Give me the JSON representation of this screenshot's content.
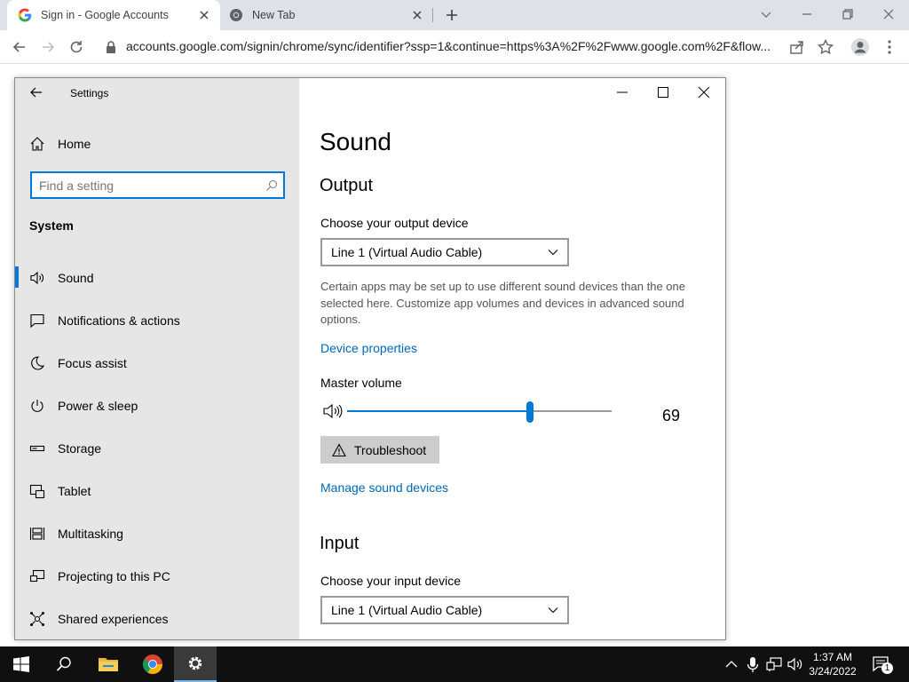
{
  "browser": {
    "tabs": [
      {
        "title": "Sign in - Google Accounts",
        "active": true,
        "icon": "google-g-icon"
      },
      {
        "title": "New Tab",
        "active": false,
        "icon": "chrome-icon"
      }
    ],
    "url": "accounts.google.com/signin/chrome/sync/identifier?ssp=1&continue=https%3A%2F%2Fwww.google.com%2F&flow..."
  },
  "settings": {
    "window_title": "Settings",
    "home_label": "Home",
    "search_placeholder": "Find a setting",
    "section_label": "System",
    "nav_items": [
      {
        "label": "Sound",
        "icon": "speaker-icon",
        "selected": true
      },
      {
        "label": "Notifications & actions",
        "icon": "notification-icon"
      },
      {
        "label": "Focus assist",
        "icon": "moon-icon"
      },
      {
        "label": "Power & sleep",
        "icon": "power-icon"
      },
      {
        "label": "Storage",
        "icon": "storage-icon"
      },
      {
        "label": "Tablet",
        "icon": "tablet-icon"
      },
      {
        "label": "Multitasking",
        "icon": "multitasking-icon"
      },
      {
        "label": "Projecting to this PC",
        "icon": "projecting-icon"
      },
      {
        "label": "Shared experiences",
        "icon": "shared-experiences-icon"
      }
    ],
    "content": {
      "title": "Sound",
      "output_heading": "Output",
      "output_device_label": "Choose your output device",
      "output_device_value": "Line 1 (Virtual Audio Cable)",
      "info_text": "Certain apps may be set up to use different sound devices than the one selected here. Customize app volumes and devices in advanced sound options.",
      "device_properties_link": "Device properties",
      "master_volume_label": "Master volume",
      "master_volume_value": "69",
      "troubleshoot_label": "Troubleshoot",
      "manage_devices_link": "Manage sound devices",
      "input_heading": "Input",
      "input_device_label": "Choose your input device",
      "input_device_value": "Line 1 (Virtual Audio Cable)"
    }
  },
  "taskbar": {
    "time": "1:37 AM",
    "date": "3/24/2022",
    "notification_count": "1",
    "accent": "#0078d7"
  }
}
